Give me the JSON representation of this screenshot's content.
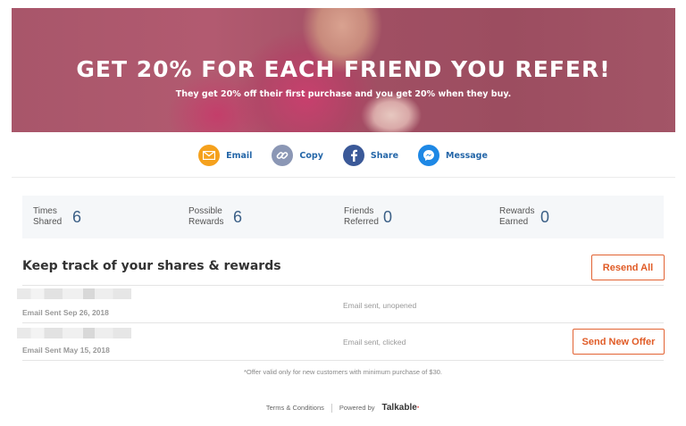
{
  "hero": {
    "title": "GET 20% FOR EACH FRIEND YOU REFER!",
    "subtitle": "They get 20% off their first purchase and you get 20% when they buy."
  },
  "share": [
    {
      "label": "Email",
      "icon": "envelope-icon",
      "color": "#f5a11d"
    },
    {
      "label": "Copy",
      "icon": "link-icon",
      "color": "#8b97b5"
    },
    {
      "label": "Share",
      "icon": "facebook-icon",
      "color": "#3b5998"
    },
    {
      "label": "Message",
      "icon": "messenger-icon",
      "color": "#1e88e5"
    }
  ],
  "stats": [
    {
      "label": "Times Shared",
      "value": "6"
    },
    {
      "label": "Possible Rewards",
      "value": "6"
    },
    {
      "label": "Friends Referred",
      "value": "0"
    },
    {
      "label": "Rewards Earned",
      "value": "0"
    }
  ],
  "track": {
    "title": "Keep track of your shares & rewards",
    "resend_label": "Resend All"
  },
  "emails": [
    {
      "date": "Email Sent Sep 26, 2018",
      "status": "Email sent, unopened"
    },
    {
      "date": "Email Sent May 15, 2018",
      "status": "Email sent, clicked",
      "action": "Send New Offer"
    }
  ],
  "disclaimer": "*Offer valid only for new customers with minimum purchase of $30.",
  "footer": {
    "terms": "Terms & Conditions",
    "powered": "Powered by",
    "brand": "Talkable"
  },
  "colors": {
    "accent": "#e05b26",
    "link": "#2466a8",
    "hero": "#a8566a"
  }
}
